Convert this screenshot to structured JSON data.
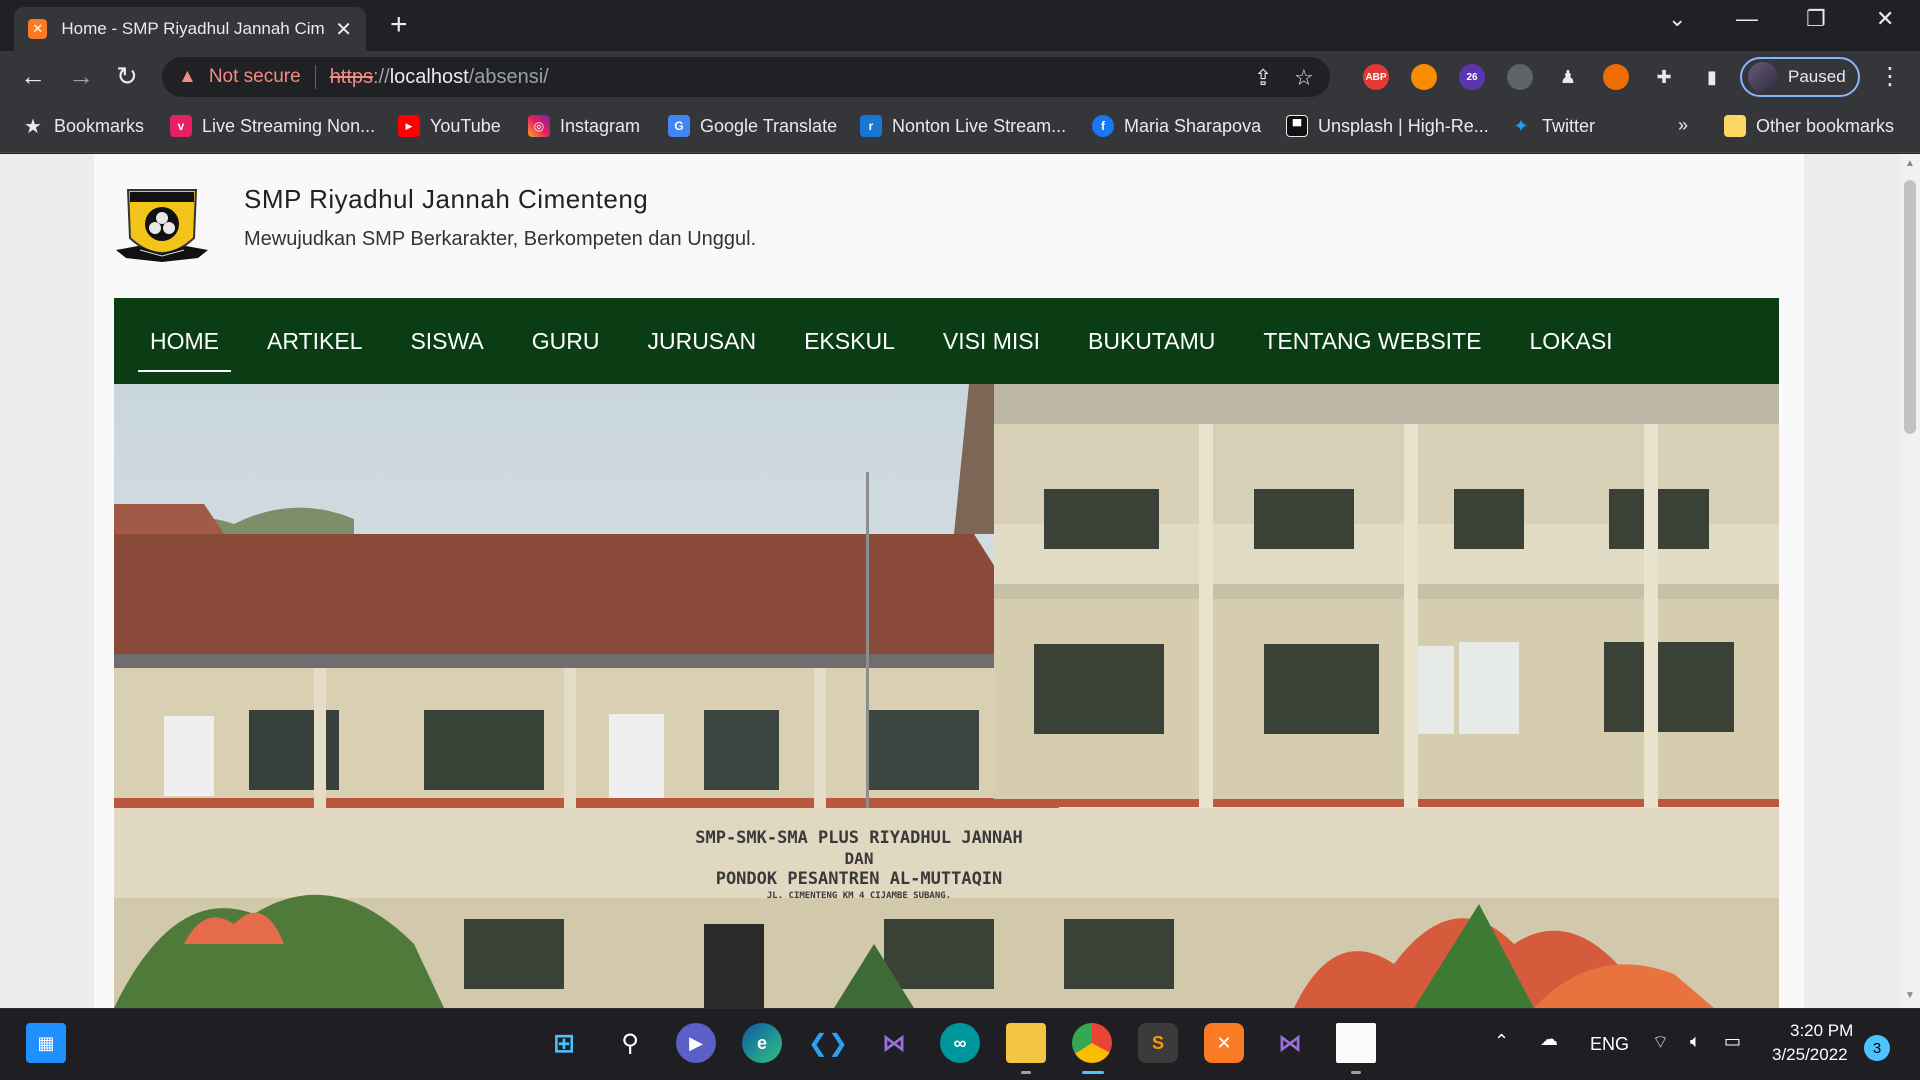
{
  "browser": {
    "tab": {
      "title": "Home - SMP Riyadhul Jannah Cimenteng",
      "favicon": "xampp-icon"
    },
    "omnibox": {
      "security_label": "Not secure",
      "url_scheme": "https",
      "url_rest": "://",
      "url_host": "localhost",
      "url_path": "/absensi/"
    },
    "extensions": {
      "abp_label": "ABP",
      "badge_count": "26"
    },
    "profile": {
      "label": "Paused"
    },
    "bookmarks": [
      {
        "label": "Bookmarks",
        "icon": "star-icon"
      },
      {
        "label": "Live Streaming Non...",
        "icon": "vidio-icon"
      },
      {
        "label": "YouTube",
        "icon": "youtube-icon"
      },
      {
        "label": "Instagram",
        "icon": "instagram-icon"
      },
      {
        "label": "Google Translate",
        "icon": "google-translate-icon"
      },
      {
        "label": "Nonton Live Stream...",
        "icon": "stream-icon"
      },
      {
        "label": "Maria Sharapova",
        "icon": "facebook-icon"
      },
      {
        "label": "Unsplash | High-Re...",
        "icon": "unsplash-icon"
      },
      {
        "label": "Twitter",
        "icon": "twitter-icon"
      }
    ],
    "overflow_label": "»",
    "other_bookmarks": "Other bookmarks"
  },
  "site": {
    "title": "SMP Riyadhul Jannah Cimenteng",
    "tagline": "Mewujudkan SMP Berkarakter, Berkompeten dan Unggul.",
    "nav": [
      "HOME",
      "ARTIKEL",
      "SISWA",
      "GURU",
      "JURUSAN",
      "EKSKUL",
      "VISI MISI",
      "BUKUTAMU",
      "TENTANG WEBSITE",
      "LOKASI"
    ],
    "hero": {
      "sign_line1": "SMP-SMK-SMA PLUS RIYADHUL JANNAH",
      "sign_line2": "DAN",
      "sign_line3": "PONDOK PESANTREN AL-MUTTAQIN",
      "sign_line4": "JL. CIMENTENG KM 4 CIJAMBE SUBANG."
    }
  },
  "taskbar": {
    "language": "ENG",
    "time": "3:20 PM",
    "date": "3/25/2022",
    "notifications": "3"
  },
  "colors": {
    "navbar_bg": "#0a3d14",
    "accent": "#8ab4f8",
    "warning": "#f28b82"
  }
}
